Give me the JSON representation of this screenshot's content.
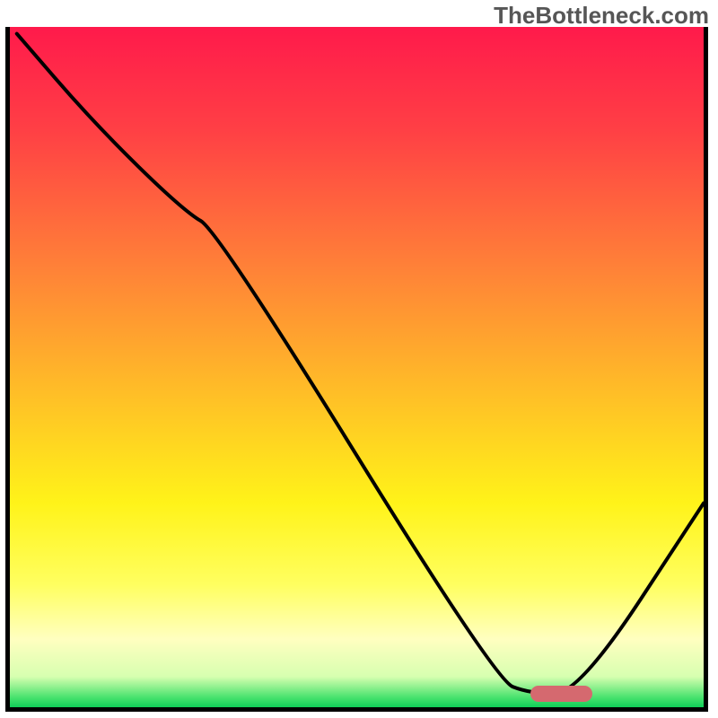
{
  "watermark": "TheBottleneck.com",
  "chart_data": {
    "type": "line",
    "title": "",
    "xlabel": "",
    "ylabel": "",
    "xlim": [
      0,
      100
    ],
    "ylim": [
      0,
      100
    ],
    "grid": false,
    "legend": false,
    "series": [
      {
        "name": "bottleneck-curve",
        "x": [
          1,
          12,
          25,
          30,
          70,
          75,
          82,
          100
        ],
        "y": [
          99,
          86,
          73,
          70,
          4,
          2,
          2,
          30
        ]
      }
    ],
    "marker": {
      "x_start": 75,
      "x_end": 84,
      "y": 2,
      "color": "#d5696f"
    },
    "background_gradient": {
      "stops": [
        {
          "pos": 0.0,
          "color": "#ff1a4b"
        },
        {
          "pos": 0.15,
          "color": "#ff3f45"
        },
        {
          "pos": 0.35,
          "color": "#ff8038"
        },
        {
          "pos": 0.55,
          "color": "#ffc226"
        },
        {
          "pos": 0.7,
          "color": "#fff319"
        },
        {
          "pos": 0.82,
          "color": "#ffff60"
        },
        {
          "pos": 0.9,
          "color": "#ffffc0"
        },
        {
          "pos": 0.955,
          "color": "#d7ffb0"
        },
        {
          "pos": 0.985,
          "color": "#4be36f"
        },
        {
          "pos": 1.0,
          "color": "#0fce58"
        }
      ]
    }
  },
  "frame": {
    "inner_width": 773,
    "inner_height": 758
  }
}
